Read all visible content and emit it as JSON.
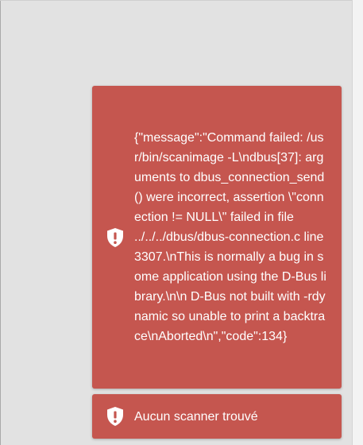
{
  "toasts": [
    {
      "type": "error",
      "icon": "shield-exclamation-icon",
      "message": "{\"message\":\"Command failed: /usr/bin/scanimage -L\\ndbus[37]: arguments to dbus_connection_send() were incorrect, assertion \\\"connection != NULL\\\" failed in file ../../../dbus/dbus-connection.c line 3307.\\nThis is normally a bug in some application using the D-Bus library.\\n\\n D-Bus not built with -rdynamic so unable to print a backtrace\\nAborted\\n\",\"code\":134}"
    },
    {
      "type": "error",
      "icon": "shield-exclamation-icon",
      "message": "Aucun scanner trouvé"
    }
  ],
  "colors": {
    "toast_background": "#c5564f",
    "toast_text": "#ffffff",
    "page_background": "#e2e2e2"
  }
}
